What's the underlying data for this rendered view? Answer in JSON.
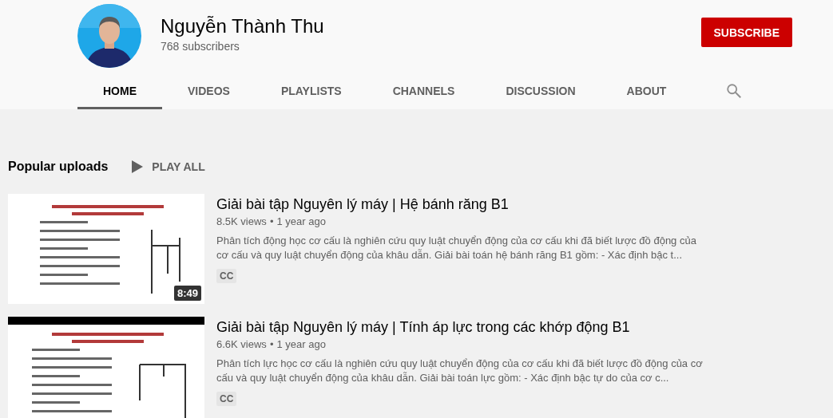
{
  "channel": {
    "name": "Nguyễn Thành Thu",
    "subscribers": "768 subscribers",
    "subscribe_button": "SUBSCRIBE"
  },
  "tabs": [
    {
      "label": "HOME",
      "selected": true
    },
    {
      "label": "VIDEOS",
      "selected": false
    },
    {
      "label": "PLAYLISTS",
      "selected": false
    },
    {
      "label": "CHANNELS",
      "selected": false
    },
    {
      "label": "DISCUSSION",
      "selected": false
    },
    {
      "label": "ABOUT",
      "selected": false
    }
  ],
  "section": {
    "title": "Popular uploads",
    "play_all": "PLAY ALL"
  },
  "videos": [
    {
      "duration": "8:49",
      "title": "Giải bài tập Nguyên lý máy | Hệ bánh răng B1",
      "views": "8.5K views",
      "separator": "•",
      "age": "1 year ago",
      "description": "Phân tích động học cơ cấu là nghiên cứu quy luật chuyển động của cơ cấu khi đã biết lược đồ động của cơ cấu và quy luật chuyển động của khâu dẫn. Giải bài toán hệ bánh răng B1 gồm: - Xác định bậc t...",
      "badge": "CC"
    },
    {
      "title": "Giải bài tập Nguyên lý máy | Tính áp lực trong các khớp động B1",
      "views": "6.6K views",
      "separator": "•",
      "age": "1 year ago",
      "description": "Phân tích lực học cơ cấu là nghiên cứu quy luật chuyển động của cơ cấu khi đã biết lược đồ động của cơ cấu và quy luật chuyển động của khâu dẫn. Giải bài toán lực gồm: - Xác định bậc tự do của cơ c...",
      "badge": "CC"
    }
  ]
}
